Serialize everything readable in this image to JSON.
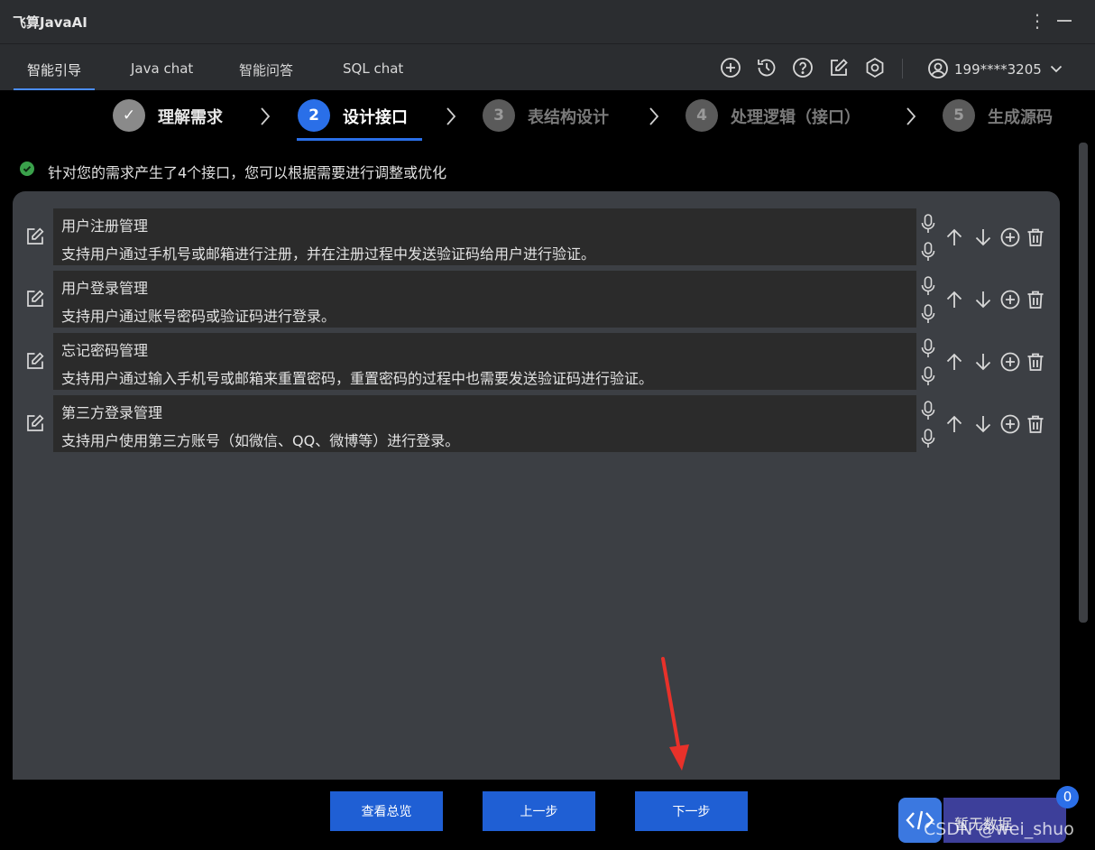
{
  "app": {
    "title": "飞算JavaAI"
  },
  "tabs": [
    {
      "label": "智能引导"
    },
    {
      "label": "Java chat"
    },
    {
      "label": "智能问答"
    },
    {
      "label": "SQL chat"
    }
  ],
  "user": {
    "name": "199****3205"
  },
  "steps": [
    {
      "num": "✓",
      "label": "理解需求",
      "state": "done"
    },
    {
      "num": "2",
      "label": "设计接口",
      "state": "active"
    },
    {
      "num": "3",
      "label": "表结构设计",
      "state": "todo"
    },
    {
      "num": "4",
      "label": "处理逻辑（接口）",
      "state": "todo"
    },
    {
      "num": "5",
      "label": "生成源码",
      "state": "todo"
    }
  ],
  "info": {
    "text": "针对您的需求产生了4个接口，您可以根据需要进行调整或优化"
  },
  "interfaces": [
    {
      "title": "用户注册管理",
      "desc": "支持用户通过手机号或邮箱进行注册，并在注册过程中发送验证码给用户进行验证。"
    },
    {
      "title": "用户登录管理",
      "desc": "支持用户通过账号密码或验证码进行登录。"
    },
    {
      "title": "忘记密码管理",
      "desc": "支持用户通过输入手机号或邮箱来重置密码，重置密码的过程中也需要发送验证码进行验证。"
    },
    {
      "title": "第三方登录管理",
      "desc": "支持用户使用第三方账号（如微信、QQ、微博等）进行登录。"
    }
  ],
  "buttons": {
    "overview": "查看总览",
    "prev": "上一步",
    "next": "下一步"
  },
  "widget": {
    "data_text": "暂无数据",
    "badge": "0",
    "icon": "code-icon"
  },
  "watermark": "CSDN @wei_shuo",
  "colors": {
    "accent": "#2a6fe8",
    "success": "#3aa14b",
    "panel": "#3c3f44",
    "annotation": "#e8312a"
  }
}
